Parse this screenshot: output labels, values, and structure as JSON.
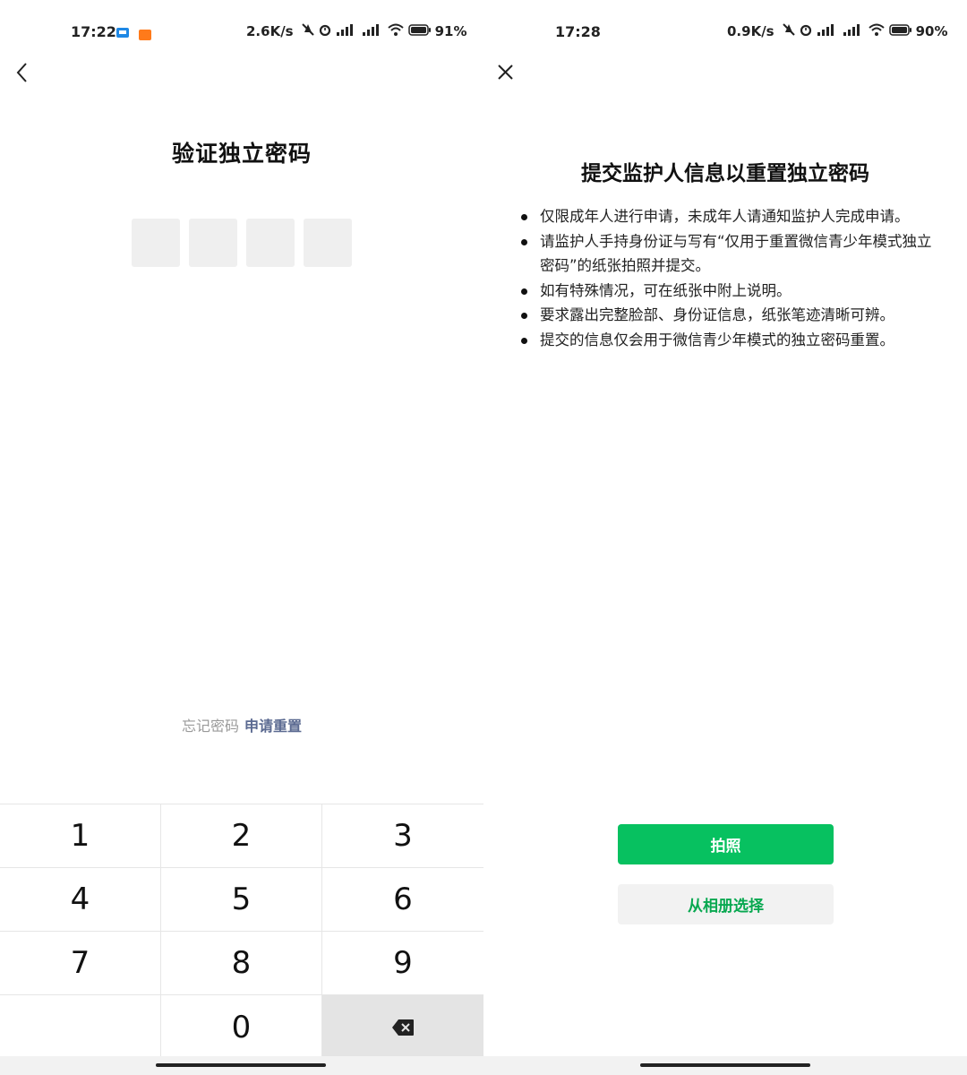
{
  "colors": {
    "accent_green": "#07c160",
    "link_blue": "#5b6a91",
    "pin_box_gray": "#efefef",
    "key_delete_bg": "#e4e4e4"
  },
  "left_screen": {
    "status_bar": {
      "time": "17:22",
      "net_speed": "2.6K/s",
      "battery": "91%"
    },
    "back_icon": "chevron-left-icon",
    "title": "验证独立密码",
    "pin_length": 4,
    "forgot_text": "忘记密码",
    "reset_link": "申请重置",
    "keypad": {
      "rows": [
        [
          "1",
          "2",
          "3"
        ],
        [
          "4",
          "5",
          "6"
        ],
        [
          "7",
          "8",
          "9"
        ],
        [
          "",
          "0",
          "⌫"
        ]
      ]
    }
  },
  "right_screen": {
    "status_bar": {
      "time": "17:28",
      "net_speed": "0.9K/s",
      "battery": "90%"
    },
    "close_icon": "close-icon",
    "title": "提交监护人信息以重置独立密码",
    "rules": [
      "仅限成年人进行申请，未成年人请通知监护人完成申请。",
      "请监护人手持身份证与写有“仅用于重置微信青少年模式独立密码”的纸张拍照并提交。",
      "如有特殊情况，可在纸张中附上说明。",
      "要求露出完整脸部、身份证信息，纸张笔迹清晰可辨。",
      "提交的信息仅会用于微信青少年模式的独立密码重置。"
    ],
    "take_photo_button": "拍照",
    "choose_album_button": "从相册选择"
  }
}
